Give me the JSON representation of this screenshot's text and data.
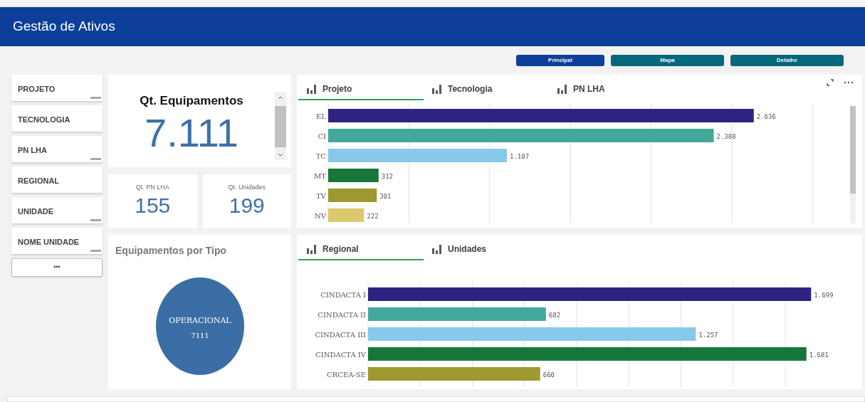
{
  "header": {
    "title": "Gestão de Ativos"
  },
  "nav_buttons": [
    {
      "label": "Principal",
      "selected": true
    },
    {
      "label": "Mapa",
      "selected": false
    },
    {
      "label": "Detalhe",
      "selected": false
    }
  ],
  "filters": [
    {
      "label": "PROJETO",
      "scroll_indicator": true
    },
    {
      "label": "TECNOLOGIA",
      "scroll_indicator": false
    },
    {
      "label": "PN LHA",
      "scroll_indicator": true
    },
    {
      "label": "REGIONAL",
      "scroll_indicator": false
    },
    {
      "label": "UNIDADE",
      "scroll_indicator": true
    },
    {
      "label": "NOME UNIDADE",
      "scroll_indicator": true
    }
  ],
  "more_filters": "•••",
  "kpi_main": {
    "title": "Qt. Equipamentos",
    "value": "7.111"
  },
  "kpi_small": [
    {
      "title": "Qt. PN LHA",
      "value": "155"
    },
    {
      "title": "Qt. Unidades",
      "value": "199"
    }
  ],
  "pie_card": {
    "title": "Equipamentos por Tipo",
    "slice": {
      "label": "OPERACIONAL",
      "value": "7111"
    }
  },
  "top_chart": {
    "tabs": [
      {
        "label": "Projeto",
        "selected": true
      },
      {
        "label": "Tecnologia",
        "selected": false
      },
      {
        "label": "PN LHA",
        "selected": false
      }
    ],
    "chart_data": {
      "type": "bar",
      "orientation": "horizontal",
      "categories": [
        "EL",
        "CI",
        "TC",
        "MT",
        "TV",
        "NV"
      ],
      "values": [
        2636,
        2388,
        1107,
        312,
        301,
        222
      ],
      "value_labels": [
        "2.636",
        "2.388",
        "1.107",
        "312",
        "301",
        "222"
      ],
      "data_labels": true,
      "colors": [
        "#2e2381",
        "#42a99a",
        "#87c9ec",
        "#17763a",
        "#9c9a2e",
        "#dcc96c"
      ]
    }
  },
  "bottom_chart": {
    "tabs": [
      {
        "label": "Regional",
        "selected": true
      },
      {
        "label": "Unidades",
        "selected": false
      }
    ],
    "chart_data": {
      "type": "bar",
      "orientation": "horizontal",
      "categories": [
        "CINDACTA I",
        "CINDACTA II",
        "CINDACTA III",
        "CINDACTA IV",
        "CRCEA-SE"
      ],
      "values": [
        1699,
        682,
        1257,
        1681,
        660
      ],
      "value_labels": [
        "1.699",
        "682",
        "1.257",
        "1.681",
        "660"
      ],
      "data_labels": true,
      "colors": [
        "#2e2381",
        "#42a99a",
        "#87c9ec",
        "#17763a",
        "#9c9a2e"
      ]
    }
  }
}
